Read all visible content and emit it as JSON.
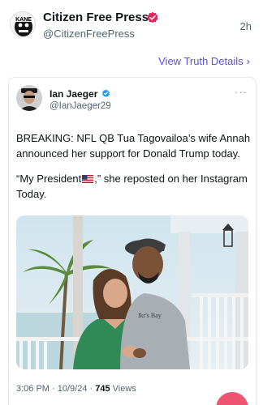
{
  "post": {
    "author_name": "Citizen Free Press",
    "author_handle": "@CitizenFreePress",
    "time": "2h",
    "view_truth_label": "View Truth Details",
    "avatar_text": "KANE"
  },
  "quoted": {
    "name": "Ian Jaeger",
    "handle": "@IanJaeger29",
    "text_line1": "BREAKING: NFL QB Tua Tagovailoa’s wife Annah announced her support for Donald Trump today.",
    "text_quote_start": "“My President",
    "text_quote_end": ",” she reposted on her Instagram Today.",
    "shirt_text": "Ikr's Bay",
    "time": "3:06 PM",
    "date": "10/9/24",
    "views_count": "745",
    "views_label": "Views"
  },
  "colors": {
    "link": "#5e4fd6",
    "verified": "#1d9bf0",
    "badge_main": "#e0245e",
    "fab": "#ee5573"
  },
  "icons": [
    "verified-badge-icon",
    "chevron-right-icon",
    "more-options-icon",
    "us-flag-icon"
  ]
}
